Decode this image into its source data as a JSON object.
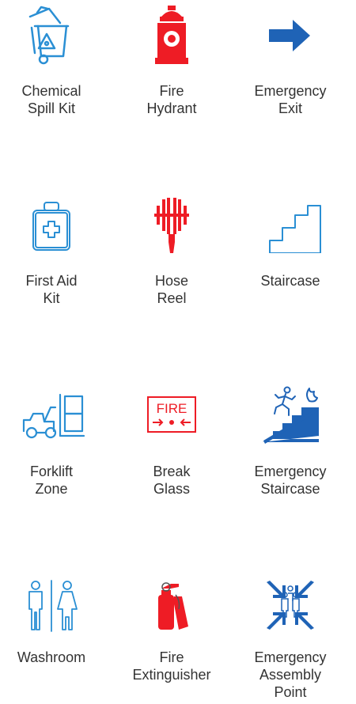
{
  "colors": {
    "blue": "#1f63b6",
    "red": "#ee1c25",
    "outline": "#2a8fd4",
    "text": "#333333"
  },
  "items": [
    {
      "label": "Chemical\nSpill Kit",
      "icon": "chemical-bin-icon"
    },
    {
      "label": "Fire\nHydrant",
      "icon": "fire-hydrant-icon"
    },
    {
      "label": "Emergency\nExit",
      "icon": "exit-arrow-icon"
    },
    {
      "label": "First Aid\nKit",
      "icon": "first-aid-kit-icon"
    },
    {
      "label": "Hose\nReel",
      "icon": "hose-reel-icon"
    },
    {
      "label": "Staircase",
      "icon": "staircase-icon"
    },
    {
      "label": "Forklift\nZone",
      "icon": "forklift-icon"
    },
    {
      "label": "Break\nGlass",
      "icon": "break-glass-icon",
      "sign_text": "FIRE"
    },
    {
      "label": "Emergency\nStaircase",
      "icon": "emergency-staircase-icon"
    },
    {
      "label": "Washroom",
      "icon": "washroom-icon"
    },
    {
      "label": "Fire\nExtinguisher",
      "icon": "fire-extinguisher-icon"
    },
    {
      "label": "Emergency\nAssembly\nPoint",
      "icon": "assembly-point-icon"
    }
  ]
}
